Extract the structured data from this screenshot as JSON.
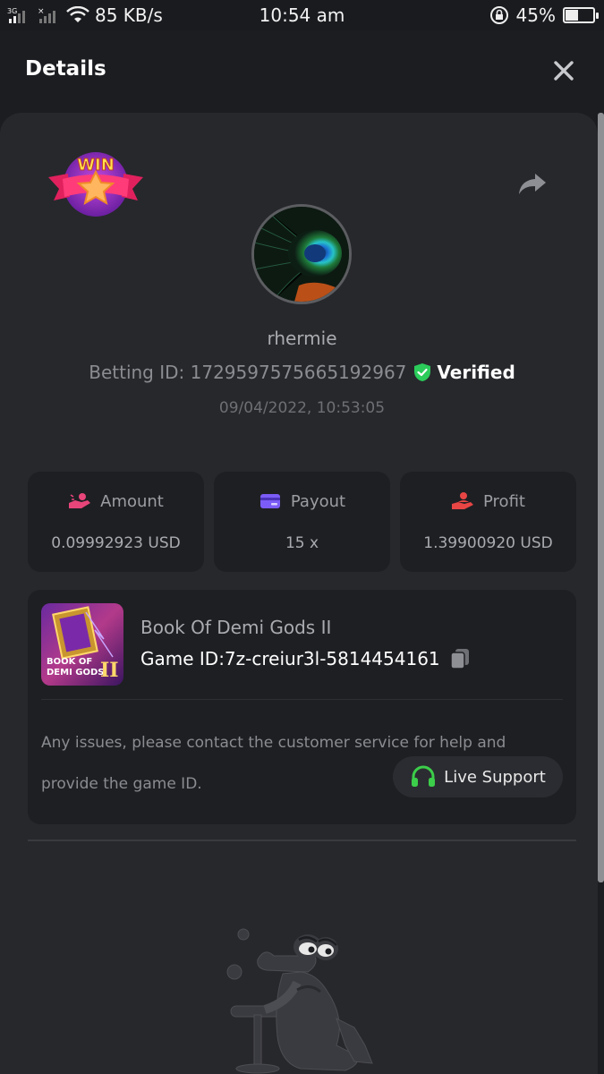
{
  "status_bar": {
    "network": "3G",
    "speed": "85 KB/s",
    "time": "10:54 am",
    "battery": "45%",
    "battery_level": 0.45
  },
  "header": {
    "title": "Details"
  },
  "user": {
    "username": "rhermie",
    "betting_id_label": "Betting ID: 1729597575665192967",
    "verified_label": "Verified",
    "datetime": "09/04/2022, 10:53:05"
  },
  "badge": {
    "text": "WIN"
  },
  "stats": [
    {
      "label": "Amount",
      "value": "0.09992923 USD",
      "icon": "hand-coin-icon",
      "color": "#e8457a"
    },
    {
      "label": "Payout",
      "value": "15 x",
      "icon": "card-icon",
      "color": "#7b5cf6"
    },
    {
      "label": "Profit",
      "value": "1.39900920 USD",
      "icon": "hand-user-icon",
      "color": "#e84545"
    }
  ],
  "game": {
    "name": "Book Of Demi Gods II",
    "id_label": "Game ID:7z-creiur3l-5814454161",
    "thumb_text_1": "BOOK OF",
    "thumb_text_2": "DEMI GODS",
    "thumb_text_3": "II",
    "issue_text": "Any issues, please contact the customer service for help and provide the game ID.",
    "support_label": "Live Support"
  },
  "colors": {
    "verified_green": "#2bcc5a",
    "support_green": "#3ccd4a"
  }
}
